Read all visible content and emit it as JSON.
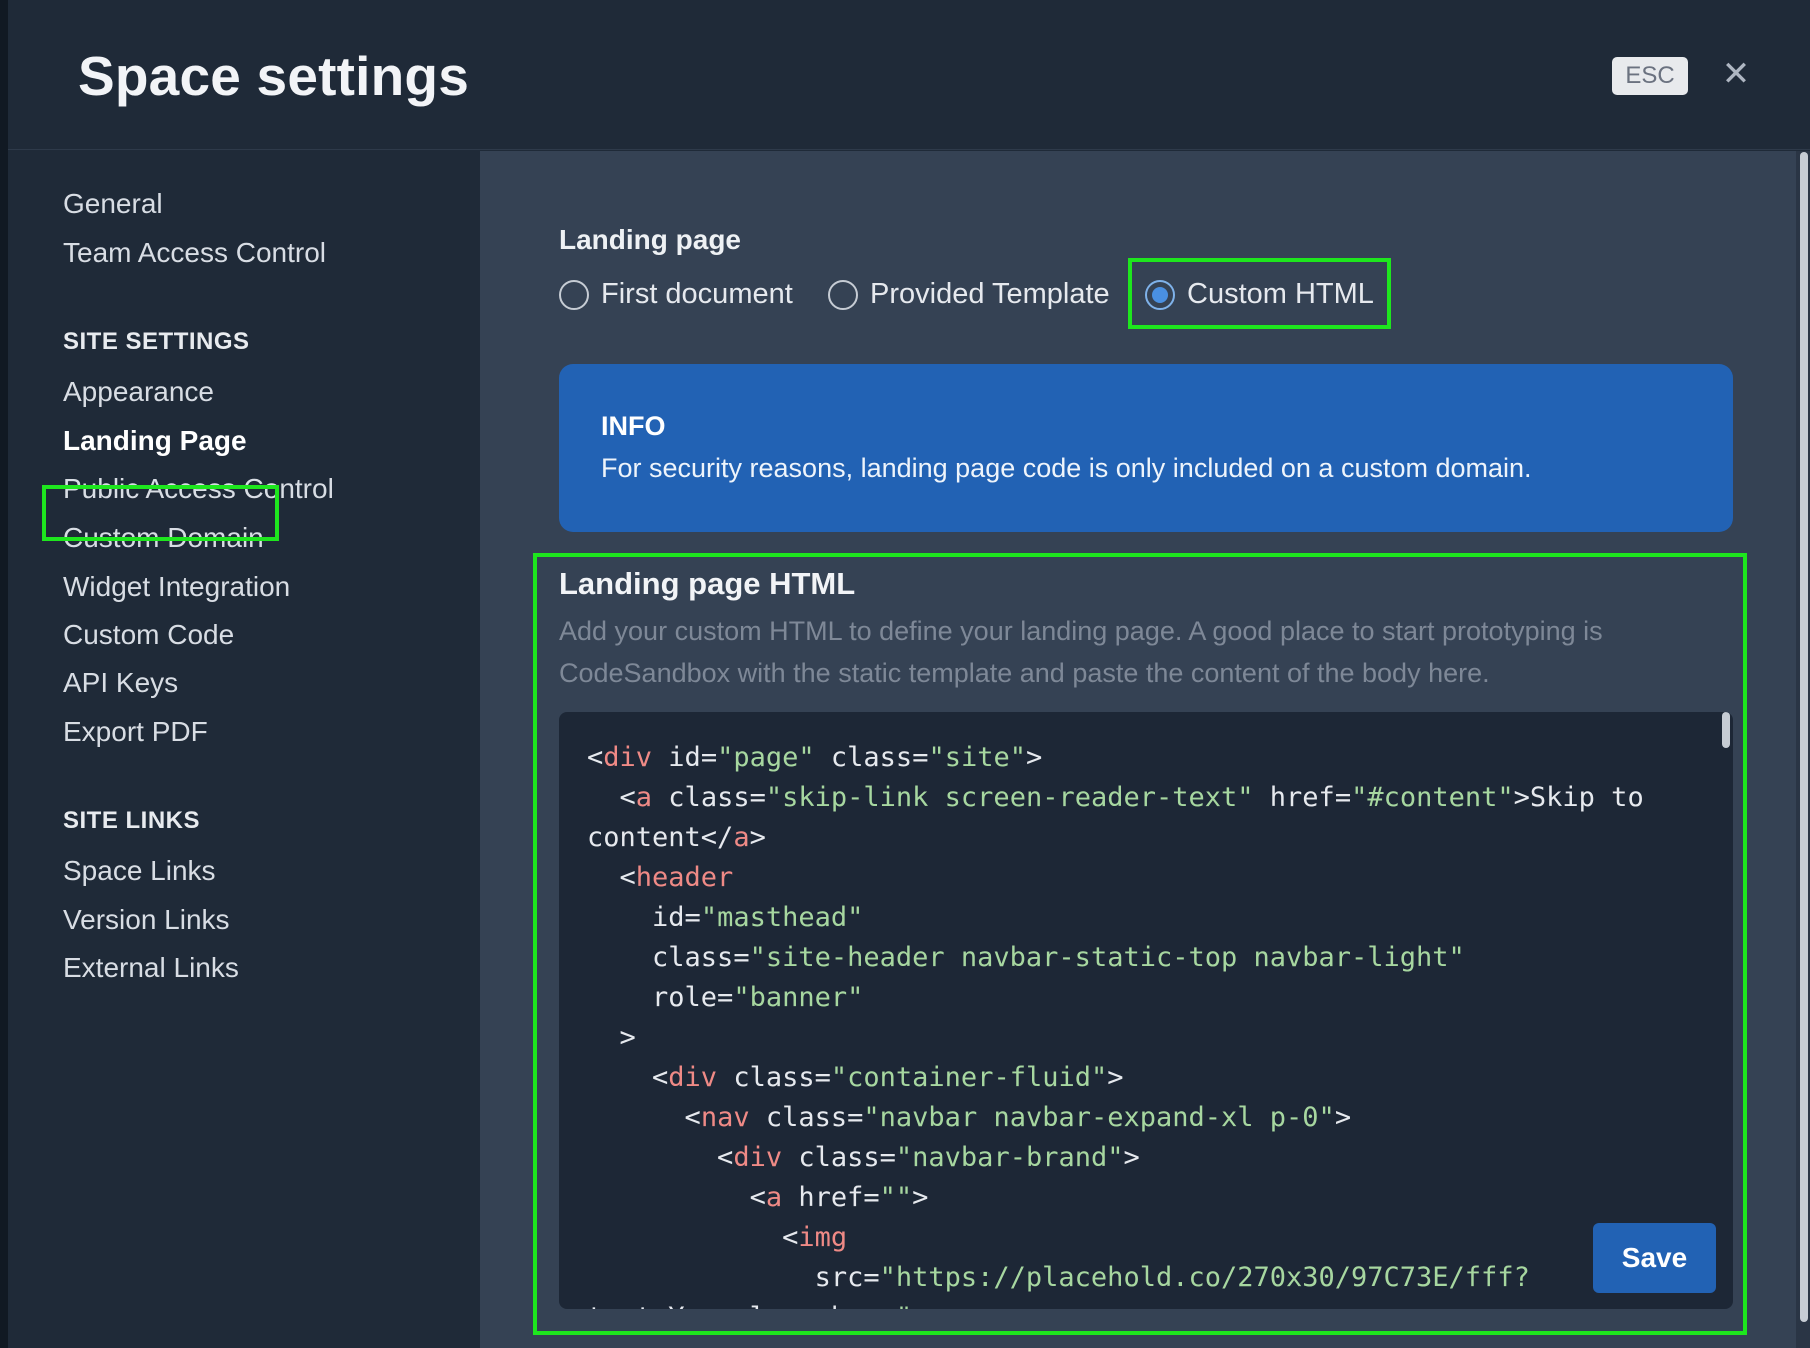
{
  "header": {
    "title": "Space settings",
    "esc_label": "ESC",
    "close_icon": "close-icon"
  },
  "sidebar": {
    "top_items": [
      {
        "label": "General"
      },
      {
        "label": "Team Access Control"
      }
    ],
    "site_settings_heading": "SITE SETTINGS",
    "site_settings_items": [
      {
        "label": "Appearance"
      },
      {
        "label": "Landing Page",
        "active": true
      },
      {
        "label": "Public Access Control"
      },
      {
        "label": "Custom Domain"
      },
      {
        "label": "Widget Integration"
      },
      {
        "label": "Custom Code"
      },
      {
        "label": "API Keys"
      },
      {
        "label": "Export PDF"
      }
    ],
    "site_links_heading": "SITE LINKS",
    "site_links_items": [
      {
        "label": "Space Links"
      },
      {
        "label": "Version Links"
      },
      {
        "label": "External Links"
      }
    ]
  },
  "main": {
    "landing_label": "Landing page",
    "radio_options": [
      {
        "label": "First document",
        "checked": false
      },
      {
        "label": "Provided Template",
        "checked": false
      },
      {
        "label": "Custom HTML",
        "checked": true
      }
    ],
    "info": {
      "title": "INFO",
      "text": "For security reasons, landing page code is only included on a custom domain."
    },
    "html_section": {
      "title": "Landing page HTML",
      "description": "Add your custom HTML to define your landing page. A good place to start prototyping is CodeSandbox with the static template and paste the content of the body here.",
      "code_lines": [
        "<div id=\"page\" class=\"site\">",
        "  <a class=\"skip-link screen-reader-text\" href=\"#content\">Skip to",
        "content</a>",
        "  <header",
        "    id=\"masthead\"",
        "    class=\"site-header navbar-static-top navbar-light\"",
        "    role=\"banner\"",
        "  >",
        "    <div class=\"container-fluid\">",
        "      <nav class=\"navbar navbar-expand-xl p-0\">",
        "        <div class=\"navbar-brand\">",
        "          <a href=\"\">",
        "            <img",
        "              src=\"https://placehold.co/270x30/97C73E/fff?",
        "text=Your+logo+here\""
      ]
    },
    "save_label": "Save"
  },
  "colors": {
    "highlight": "#1ee61e",
    "accent": "#2262b4"
  }
}
